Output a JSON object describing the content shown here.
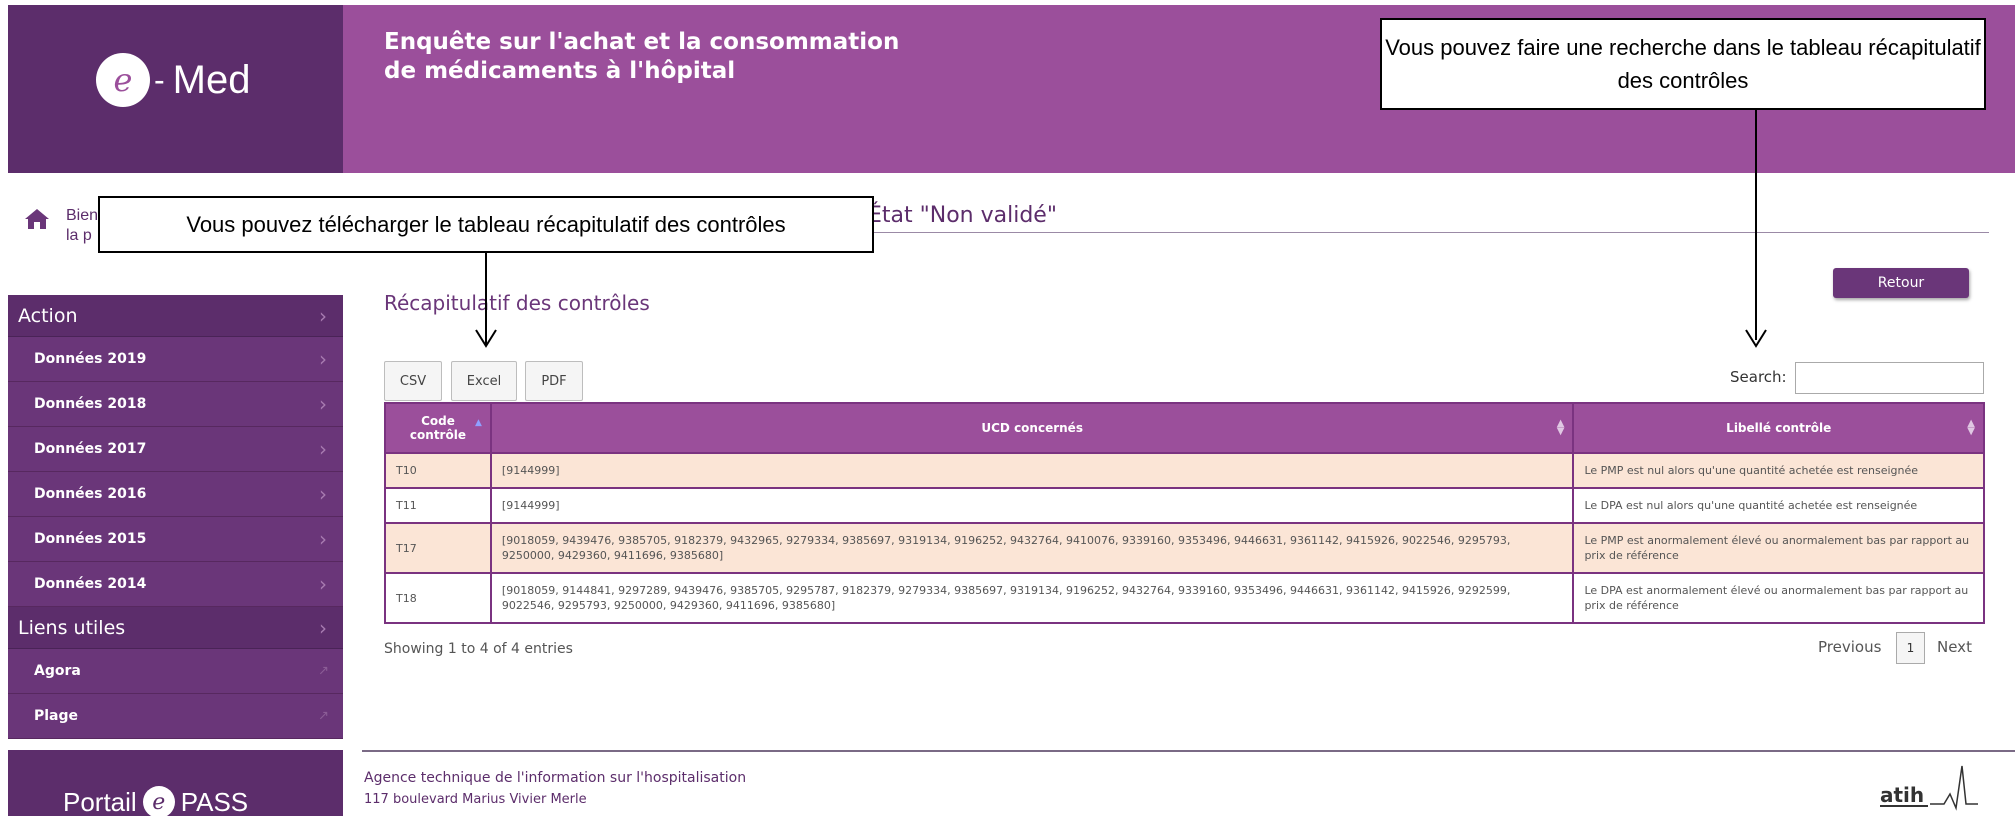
{
  "header": {
    "logo_letter": "e",
    "logo_dash": "-",
    "logo_text": "Med",
    "title_line1": "Enquête sur l'achat et la consommation",
    "title_line2": "de médicaments à l'hôpital"
  },
  "callouts": {
    "search": "Vous pouvez faire une recherche dans le tableau récapitulatif des contrôles",
    "download": "Vous pouvez télécharger le tableau récapitulatif des contrôles"
  },
  "breadcrumb": {
    "line1_visible": "Bien",
    "line2_visible": "la p",
    "state": "État \"Non validé\""
  },
  "sidebar": {
    "action_label": "Action",
    "items": [
      {
        "label": "Données 2019"
      },
      {
        "label": "Données 2018"
      },
      {
        "label": "Données 2017"
      },
      {
        "label": "Données 2016"
      },
      {
        "label": "Données 2015"
      },
      {
        "label": "Données 2014"
      }
    ],
    "links_label": "Liens utiles",
    "links": [
      {
        "label": "Agora"
      },
      {
        "label": "Plage"
      }
    ],
    "portail_left": "Portail",
    "portail_letter": "e",
    "portail_right": "PASS"
  },
  "main": {
    "section_title": "Récapitulatif des contrôles",
    "retour_label": "Retour",
    "export_buttons": {
      "csv": "CSV",
      "excel": "Excel",
      "pdf": "PDF"
    },
    "search_label": "Search:",
    "search_value": ""
  },
  "table": {
    "headers": {
      "code_line1": "Code",
      "code_line2": "contrôle",
      "ucd": "UCD concernés",
      "libelle": "Libellé contrôle"
    },
    "rows": [
      {
        "code": "T10",
        "ucd": "[9144999]",
        "libelle": "Le PMP est nul alors qu'une quantité achetée est renseignée"
      },
      {
        "code": "T11",
        "ucd": "[9144999]",
        "libelle": "Le DPA est nul alors qu'une quantité achetée est renseignée"
      },
      {
        "code": "T17",
        "ucd": "[9018059, 9439476, 9385705, 9182379, 9432965, 9279334, 9385697, 9319134, 9196252, 9432764, 9410076, 9339160, 9353496, 9446631, 9361142, 9415926, 9022546, 9295793, 9250000, 9429360, 9411696, 9385680]",
        "libelle": "Le PMP est anormalement élevé ou anormalement bas par rapport au prix de référence"
      },
      {
        "code": "T18",
        "ucd": "[9018059, 9144841, 9297289, 9439476, 9385705, 9295787, 9182379, 9279334, 9385697, 9319134, 9196252, 9432764, 9339160, 9353496, 9446631, 9361142, 9415926, 9292599, 9022546, 9295793, 9250000, 9429360, 9411696, 9385680]",
        "libelle": "Le DPA est anormalement élevé ou anormalement bas par rapport au prix de référence"
      }
    ]
  },
  "pagination": {
    "info": "Showing 1 to 4 of 4 entries",
    "previous": "Previous",
    "page": "1",
    "next": "Next"
  },
  "footer": {
    "org": "Agence technique de l'information sur l'hospitalisation",
    "address": "117 boulevard Marius Vivier Merle",
    "logo_text": "atih"
  },
  "colors": {
    "primary": "#9b4f9b",
    "dark": "#5c2d6b",
    "row_highlight": "#fbe5d6"
  }
}
